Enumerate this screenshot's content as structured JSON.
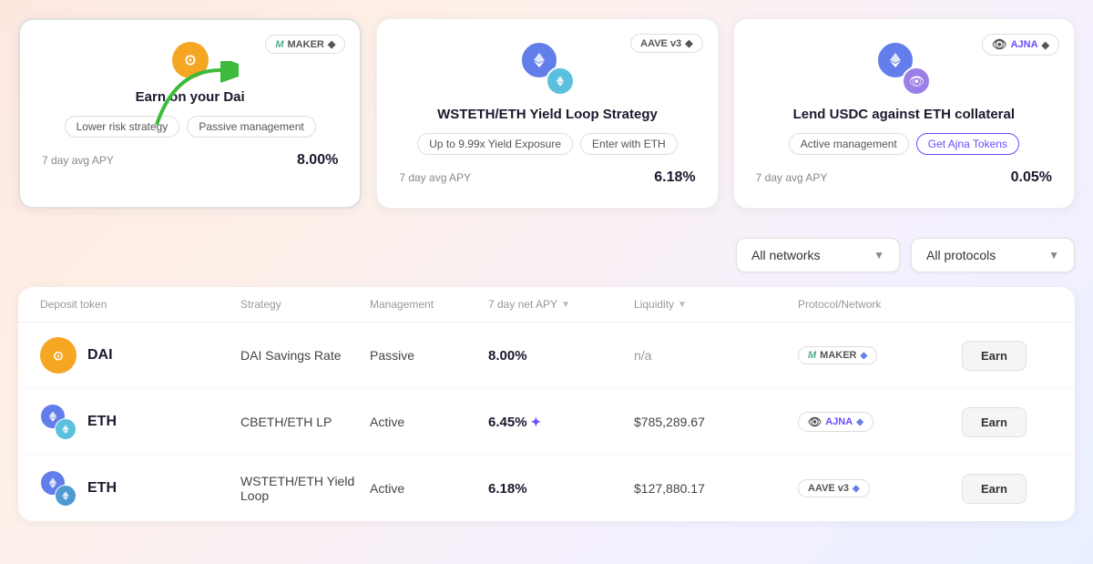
{
  "featured_cards": [
    {
      "id": "dai",
      "title": "Earn on your Dai",
      "icon_type": "dai",
      "badges": [
        "Lower risk strategy",
        "Passive management"
      ],
      "apy_label": "7 day avg APY",
      "apy_value": "8.00%",
      "protocol": "MAKER",
      "protocol_has_eth": true
    },
    {
      "id": "eth-loop",
      "title": "WSTETH/ETH Yield Loop Strategy",
      "icon_type": "eth-double",
      "badges": [
        "Up to 9.99x Yield Exposure",
        "Enter with ETH"
      ],
      "apy_label": "7 day avg APY",
      "apy_value": "6.18%",
      "protocol": "AAVE v3",
      "protocol_has_eth": true
    },
    {
      "id": "usdc-eth",
      "title": "Lend USDC against ETH collateral",
      "icon_type": "ajna-dual",
      "badges_normal": [
        "Active management"
      ],
      "badge_special": "Get Ajna Tokens",
      "apy_label": "7 day avg APY",
      "apy_value": "0.05%",
      "protocol": "AJNA",
      "protocol_has_eth": true
    }
  ],
  "filters": {
    "networks_label": "All networks",
    "protocols_label": "All protocols"
  },
  "table": {
    "headers": [
      {
        "key": "deposit",
        "label": "Deposit token",
        "sortable": false
      },
      {
        "key": "strategy",
        "label": "Strategy",
        "sortable": false
      },
      {
        "key": "management",
        "label": "Management",
        "sortable": false
      },
      {
        "key": "apy",
        "label": "7 day net APY",
        "sortable": true
      },
      {
        "key": "liquidity",
        "label": "Liquidity",
        "sortable": true
      },
      {
        "key": "protocol",
        "label": "Protocol/Network",
        "sortable": false
      },
      {
        "key": "action",
        "label": "",
        "sortable": false
      }
    ],
    "rows": [
      {
        "token": "DAI",
        "token_type": "dai",
        "strategy": "DAI Savings Rate",
        "management": "Passive",
        "apy": "8.00%",
        "apy_special": false,
        "liquidity": "n/a",
        "liquidity_type": "na",
        "protocol": "MAKER",
        "protocol_type": "maker",
        "action": "Earn"
      },
      {
        "token": "ETH",
        "token_type": "eth-double",
        "strategy": "CBETH/ETH LP",
        "management": "Active",
        "apy": "6.45%",
        "apy_special": true,
        "liquidity": "$785,289.67",
        "liquidity_type": "value",
        "protocol": "AJNA",
        "protocol_type": "ajna",
        "action": "Earn"
      },
      {
        "token": "ETH",
        "token_type": "eth-blue",
        "strategy": "WSTETH/ETH Yield Loop",
        "management": "Active",
        "apy": "6.18%",
        "apy_special": false,
        "liquidity": "$127,880.17",
        "liquidity_type": "value",
        "protocol": "AAVE v3",
        "protocol_type": "aave",
        "action": "Earn"
      }
    ]
  }
}
